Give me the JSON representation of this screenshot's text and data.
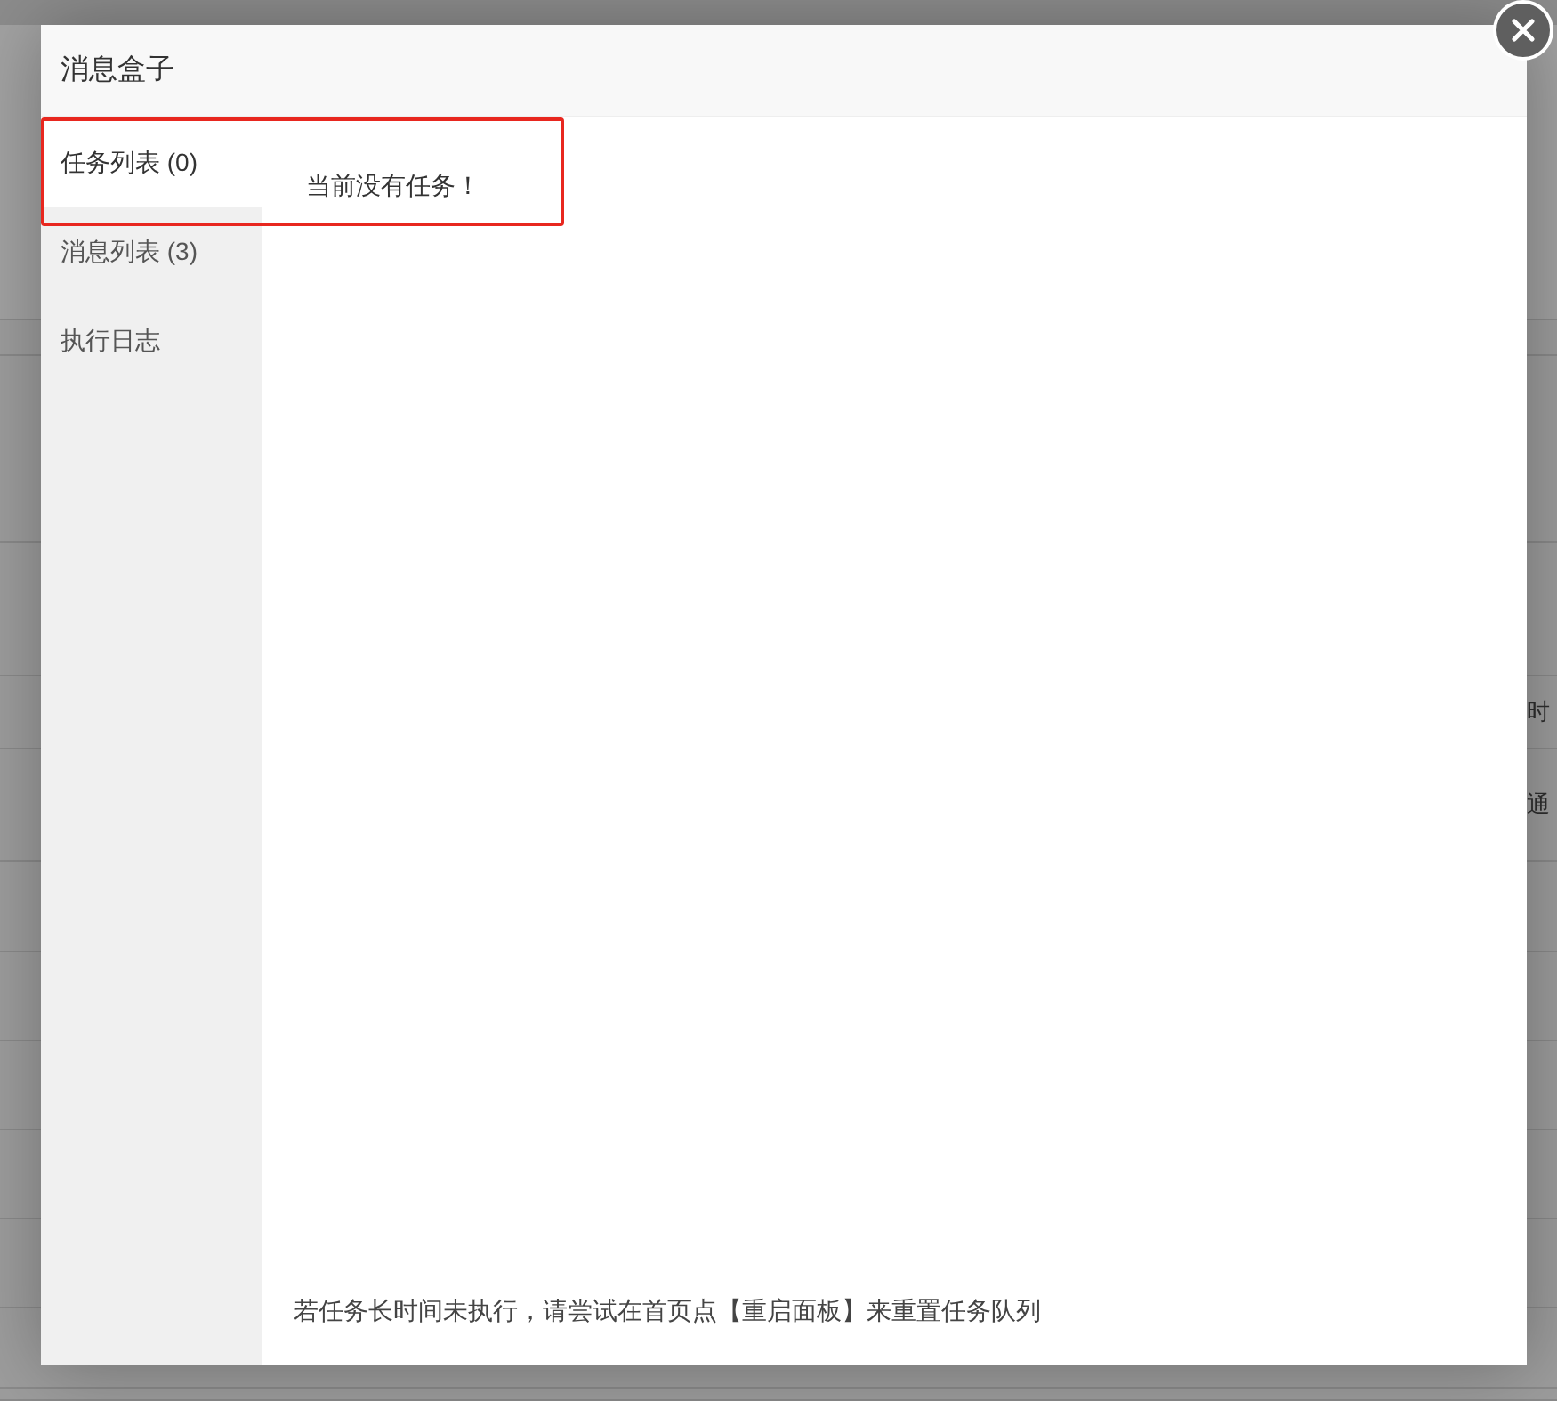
{
  "background": {
    "texts": [
      "时",
      "通"
    ]
  },
  "dialog": {
    "title": "消息盒子",
    "highlight_frame": true,
    "tabs": [
      {
        "label": "任务列表 (0)",
        "selected": true
      },
      {
        "label": "消息列表 (3)",
        "selected": false
      },
      {
        "label": "执行日志",
        "selected": false
      }
    ],
    "message": "当前没有任务！",
    "footer_note": "若任务长时间未执行，请尝试在首页点【重启面板】来重置任务队列"
  }
}
